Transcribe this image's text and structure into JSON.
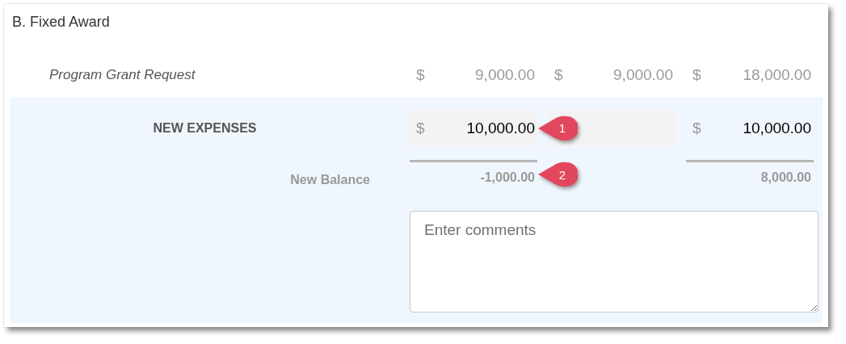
{
  "section": {
    "title": "B. Fixed Award"
  },
  "grant_row": {
    "label": "Program Grant Request",
    "cells": [
      {
        "currency": "$",
        "amount": "9,000.00"
      },
      {
        "currency": "$",
        "amount": "9,000.00"
      },
      {
        "currency": "$",
        "amount": "18,000.00"
      }
    ]
  },
  "expenses_row": {
    "label": "NEW EXPENSES",
    "fields": [
      {
        "kind": "input",
        "currency": "$",
        "value": "10,000.00"
      },
      {
        "kind": "input"
      },
      {
        "kind": "total",
        "currency": "$",
        "value": "10,000.00"
      }
    ]
  },
  "balance_row": {
    "label": "New Balance",
    "cells": [
      {
        "kind": "balance",
        "value": "-1,000.00"
      },
      {
        "kind": "none"
      },
      {
        "kind": "balance",
        "value": "8,000.00"
      }
    ]
  },
  "comments": {
    "placeholder": "Enter comments"
  },
  "callouts": [
    {
      "number": "1"
    },
    {
      "number": "2"
    }
  ]
}
